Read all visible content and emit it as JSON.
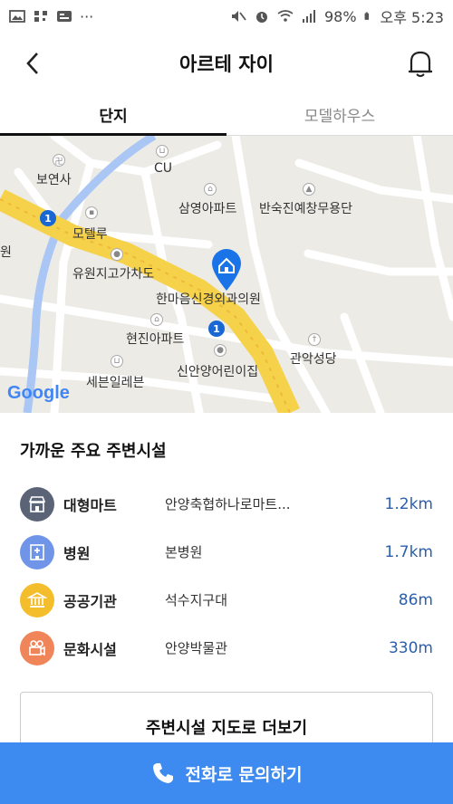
{
  "statusbar": {
    "battery": "98%",
    "time": "오후 5:23",
    "overflow": "···"
  },
  "appbar": {
    "title": "아르테 자이"
  },
  "tabs": [
    {
      "label": "단지",
      "active": true
    },
    {
      "label": "모델하우스",
      "active": false
    }
  ],
  "map": {
    "labels": {
      "boyeonsa": "보연사",
      "cu": "CU",
      "samyoung": "삼영아파트",
      "bansukjin": "반숙진예창무용단",
      "motel": "모텔루",
      "yuwon": "유원지고가차도",
      "hanmaeum": "한마음신경외과의원",
      "hyeonjin": "현진아파트",
      "gwanak": "관악성당",
      "sinan": "신안양어린이집",
      "seven": "세븐일레븐",
      "left_edge": "원"
    },
    "route_number": "1",
    "attribution": "Google"
  },
  "facilities": {
    "title": "가까운 주요 주변시설",
    "items": [
      {
        "category": "대형마트",
        "name": "안양축협하나로마트...",
        "distance": "1.2km",
        "icon": "store-icon",
        "color": "#5b6377"
      },
      {
        "category": "병원",
        "name": "본병원",
        "distance": "1.7km",
        "icon": "hospital-icon",
        "color": "#6f94e8"
      },
      {
        "category": "공공기관",
        "name": "석수지구대",
        "distance": "86m",
        "icon": "government-icon",
        "color": "#f4bd2c"
      },
      {
        "category": "문화시설",
        "name": "안양박물관",
        "distance": "330m",
        "icon": "camera-icon",
        "color": "#f0855a"
      }
    ],
    "more_label": "주변시설 지도로 더보기"
  },
  "call": {
    "label": "전화로 문의하기"
  }
}
